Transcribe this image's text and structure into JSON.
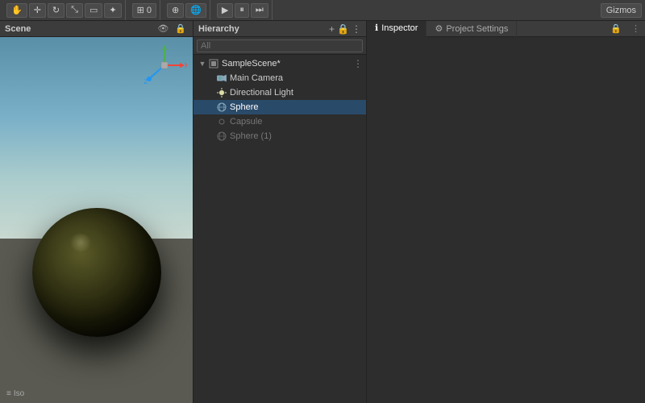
{
  "toolbar": {
    "gizmos_label": "Gizmos",
    "iso_label": "Iso"
  },
  "hierarchy": {
    "title": "Hierarchy",
    "search_placeholder": "All",
    "scene_name": "SampleScene*",
    "items": [
      {
        "label": "Main Camera",
        "indent": "child",
        "icon": "camera"
      },
      {
        "label": "Directional Light",
        "indent": "child",
        "icon": "light"
      },
      {
        "label": "Sphere",
        "indent": "child",
        "icon": "mesh",
        "selected": true
      },
      {
        "label": "Capsule",
        "indent": "child",
        "icon": "mesh",
        "dimmed": true
      },
      {
        "label": "Sphere (1)",
        "indent": "child",
        "icon": "mesh",
        "dimmed": true
      }
    ]
  },
  "inspector": {
    "title": "Inspector",
    "lock_icon": "🔒"
  },
  "project_settings": {
    "title": "Project Settings",
    "gear_icon": "⚙",
    "lock_icon": "🔒"
  }
}
